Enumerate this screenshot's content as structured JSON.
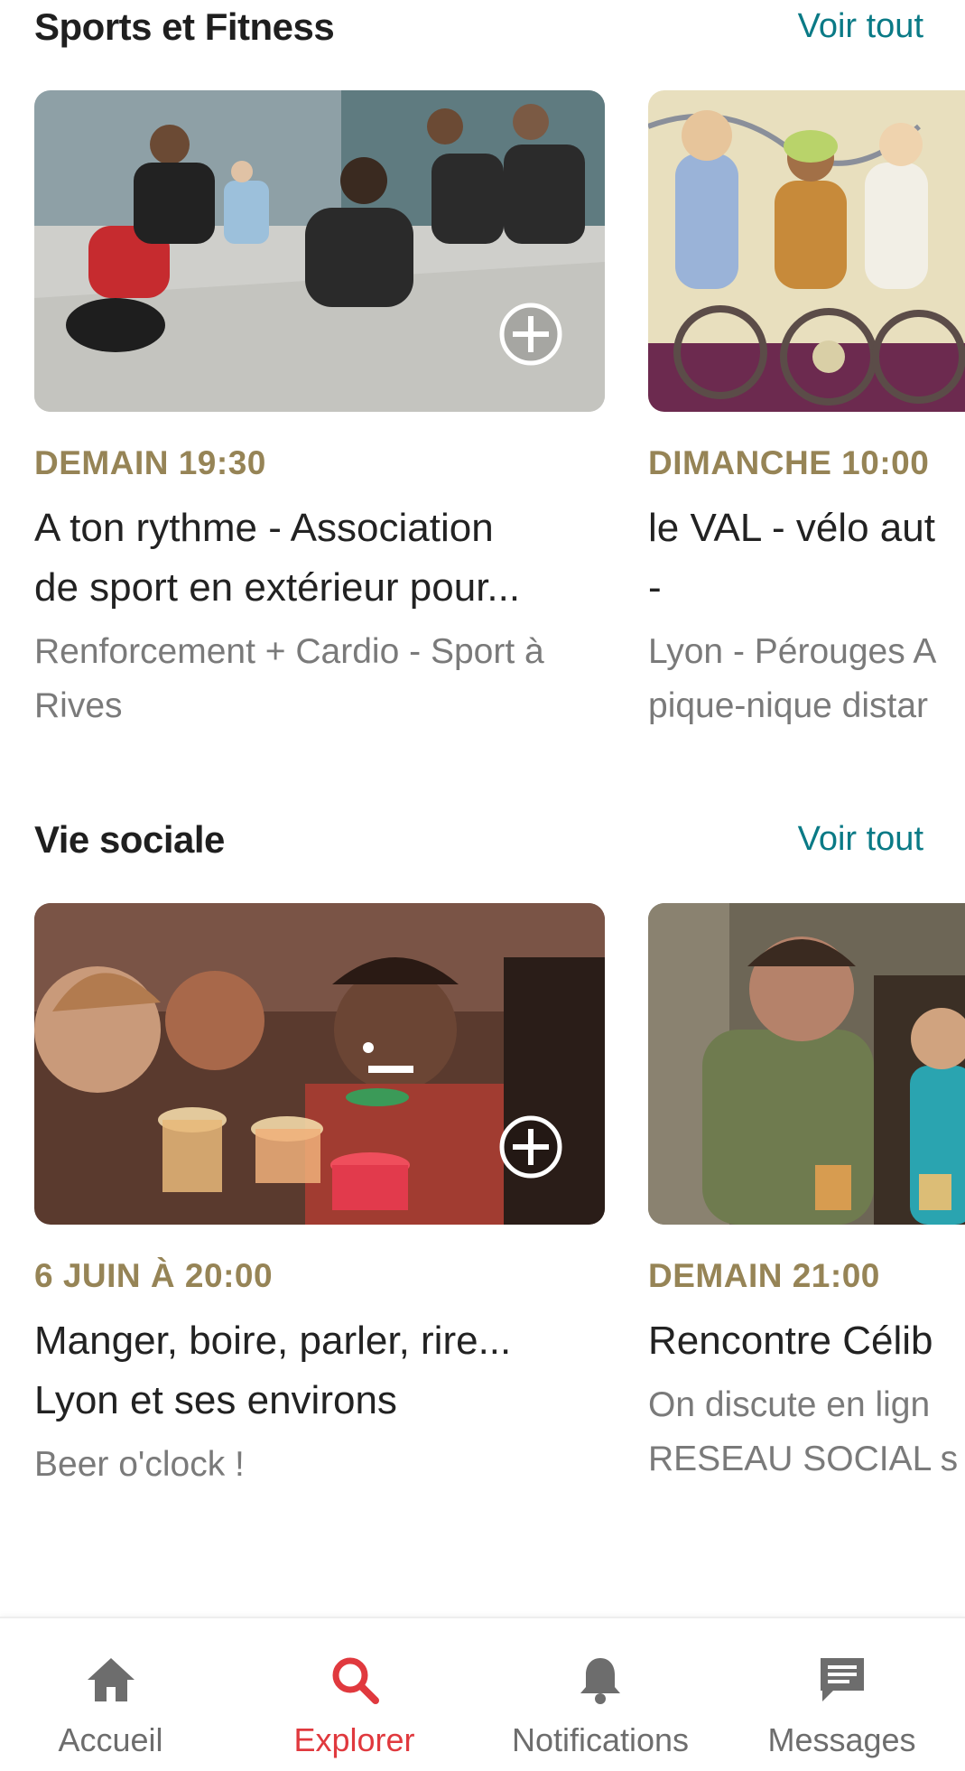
{
  "sections": [
    {
      "title": "Sports et Fitness",
      "see_all": "Voir tout",
      "cards": [
        {
          "when": "DEMAIN 19:30",
          "title_lines": [
            "A ton rythme - Association",
            "de sport en extérieur pour..."
          ],
          "sub_lines": [
            "Renforcement + Cardio - Sport à",
            "Rives"
          ]
        },
        {
          "when": "DIMANCHE 10:00",
          "title_lines": [
            "le VAL - vélo aut",
            "-"
          ],
          "sub_lines": [
            "Lyon - Pérouges A",
            "pique-nique distar"
          ]
        }
      ]
    },
    {
      "title": "Vie sociale",
      "see_all": "Voir tout",
      "cards": [
        {
          "when": "6 JUIN À 20:00",
          "title_lines": [
            "Manger, boire, parler, rire...",
            "Lyon et ses environs"
          ],
          "sub_lines": [
            "Beer o'clock !"
          ]
        },
        {
          "when": "DEMAIN 21:00",
          "title_lines": [
            "Rencontre Célib"
          ],
          "sub_lines": [
            "On discute en lign",
            "RESEAU SOCIAL s"
          ]
        }
      ]
    }
  ],
  "tabbar": {
    "items": [
      {
        "label": "Accueil",
        "icon": "home-icon",
        "active": false
      },
      {
        "label": "Explorer",
        "icon": "search-icon",
        "active": true
      },
      {
        "label": "Notifications",
        "icon": "bell-icon",
        "active": false
      },
      {
        "label": "Messages",
        "icon": "message-icon",
        "active": false
      }
    ]
  },
  "colors": {
    "accent_teal": "#0a7a86",
    "date_gold": "#968456",
    "active_red": "#e0393e",
    "inactive_gray": "#6d6d6d"
  }
}
